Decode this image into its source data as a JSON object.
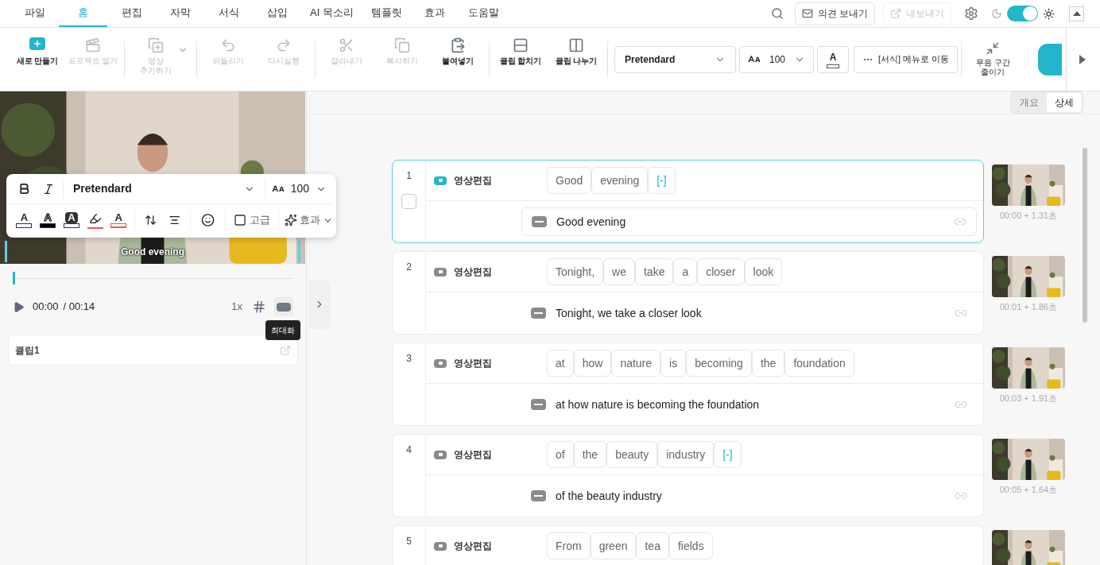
{
  "menu_tabs": [
    {
      "label": "파일",
      "selected": false
    },
    {
      "label": "홈",
      "selected": true
    },
    {
      "label": "편집",
      "selected": false
    },
    {
      "label": "자막",
      "selected": false
    },
    {
      "label": "서식",
      "selected": false
    },
    {
      "label": "삽입",
      "selected": false
    },
    {
      "label": "AI 목소리",
      "selected": false
    },
    {
      "label": "템플릿",
      "selected": false
    },
    {
      "label": "효과",
      "selected": false
    },
    {
      "label": "도움말",
      "selected": false
    }
  ],
  "header_actions": {
    "feedback": {
      "label": "의견 보내기",
      "disabled": false
    },
    "export": {
      "label": "내보내기",
      "disabled": true
    },
    "dark_mode": {
      "on": true
    }
  },
  "toolbar": [
    {
      "label": "새로 만들기",
      "kind": "new",
      "disabled": false
    },
    {
      "label": "프로젝트 열기",
      "kind": "open",
      "disabled": true
    },
    {
      "label": "영상\n추가하기",
      "kind": "add-video",
      "disabled": true
    },
    {
      "label": "되돌리기",
      "kind": "undo",
      "disabled": true
    },
    {
      "label": "다시실행",
      "kind": "redo",
      "disabled": true
    },
    {
      "label": "잘라내기",
      "kind": "cut",
      "disabled": true
    },
    {
      "label": "복사하기",
      "kind": "copy",
      "disabled": true
    },
    {
      "label": "붙여넣기",
      "kind": "paste",
      "disabled": false
    },
    {
      "label": "클립 합치기",
      "kind": "merge",
      "disabled": false
    },
    {
      "label": "클립 나누기",
      "kind": "split",
      "disabled": false
    }
  ],
  "format": {
    "font": "Pretendard",
    "size": "100",
    "text_color_label": "A",
    "menu_link": "[서식] 메뉴로 이동",
    "silence_label": "무음 구간\n줄이기"
  },
  "preview": {
    "subtitle": "Good evening",
    "popup": {
      "font": "Pretendard",
      "size": "100",
      "styles": [
        {
          "label": "A",
          "kind": "plain"
        },
        {
          "label": "A",
          "kind": "outline"
        },
        {
          "label": "A",
          "kind": "box"
        },
        {
          "kind": "highlight"
        },
        {
          "label": "A",
          "kind": "underline"
        }
      ],
      "advanced": "고급",
      "effects": "효과"
    },
    "progress": {
      "level": 0.0
    },
    "current_time": "00:00",
    "total_time": "/ 00:14",
    "speed": "1x",
    "tooltip": "최대화"
  },
  "clip_card": {
    "title": "클립1"
  },
  "view_switch": [
    {
      "label": "개요",
      "selected": false
    },
    {
      "label": "상세",
      "selected": true
    }
  ],
  "clips": [
    {
      "number": "1",
      "selected": true,
      "checked": false,
      "title": "영상편집",
      "words": [
        {
          "text": "Good",
          "kind": "word"
        },
        {
          "text": "evening",
          "kind": "word"
        },
        {
          "text": "[-]",
          "kind": "silence"
        }
      ],
      "subtitle": "Good evening",
      "time": "00:00 + 1.31초"
    },
    {
      "number": "2",
      "selected": false,
      "title": "영상편집",
      "words": [
        {
          "text": "Tonight,",
          "kind": "word"
        },
        {
          "text": "we",
          "kind": "word"
        },
        {
          "text": "take",
          "kind": "word"
        },
        {
          "text": "a",
          "kind": "word"
        },
        {
          "text": "closer",
          "kind": "word"
        },
        {
          "text": "look",
          "kind": "word"
        }
      ],
      "subtitle": "Tonight, we take a closer look",
      "time": "00:01 + 1.86초"
    },
    {
      "number": "3",
      "selected": false,
      "title": "영상편집",
      "words": [
        {
          "text": "at",
          "kind": "word"
        },
        {
          "text": "how",
          "kind": "word"
        },
        {
          "text": "nature",
          "kind": "word"
        },
        {
          "text": "is",
          "kind": "word"
        },
        {
          "text": "becoming",
          "kind": "word"
        },
        {
          "text": "the",
          "kind": "word"
        },
        {
          "text": "foundation",
          "kind": "word"
        }
      ],
      "subtitle": "at how nature is becoming the foundation",
      "time": "00:03 + 1.91초"
    },
    {
      "number": "4",
      "selected": false,
      "title": "영상편집",
      "words": [
        {
          "text": "of",
          "kind": "word"
        },
        {
          "text": "the",
          "kind": "word"
        },
        {
          "text": "beauty",
          "kind": "word"
        },
        {
          "text": "industry",
          "kind": "word"
        },
        {
          "text": "[-]",
          "kind": "silence"
        }
      ],
      "subtitle": "of the beauty industry",
      "time": "00:05 + 1.64초"
    },
    {
      "number": "5",
      "selected": false,
      "title": "영상편집",
      "words": [
        {
          "text": "From",
          "kind": "word"
        },
        {
          "text": "green",
          "kind": "word"
        },
        {
          "text": "tea",
          "kind": "word"
        },
        {
          "text": "fields",
          "kind": "word"
        }
      ]
    }
  ]
}
